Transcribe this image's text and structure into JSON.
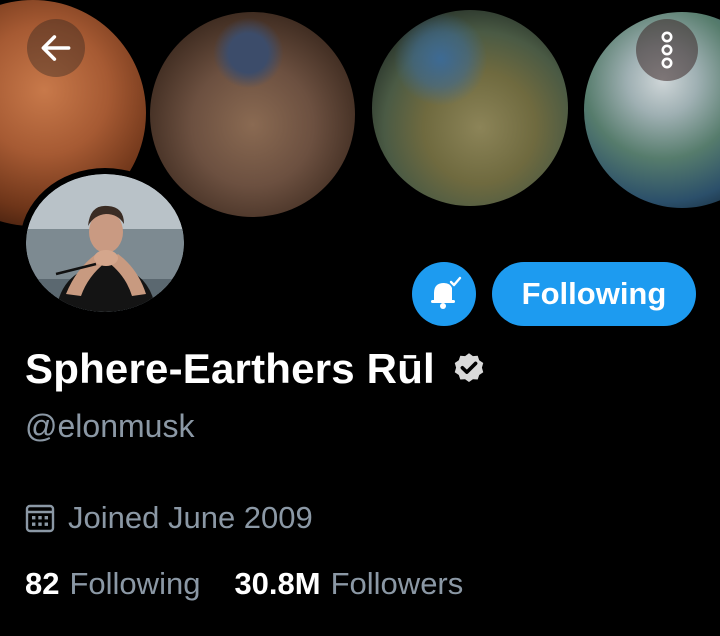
{
  "header": {
    "back_icon": "arrow-left-icon",
    "more_icon": "more-vertical-icon"
  },
  "profile": {
    "display_name": "Sphere-Earthers Rūl",
    "handle": "@elonmusk",
    "verified": true,
    "joined": "Joined June 2009",
    "following_count": "82",
    "following_label": "Following",
    "followers_count": "30.8M",
    "followers_label": "Followers"
  },
  "actions": {
    "notify_icon": "bell-check-icon",
    "follow_label": "Following"
  },
  "colors": {
    "accent": "#1d9bf0",
    "secondary_text": "#8b98a5",
    "background": "#000000"
  }
}
